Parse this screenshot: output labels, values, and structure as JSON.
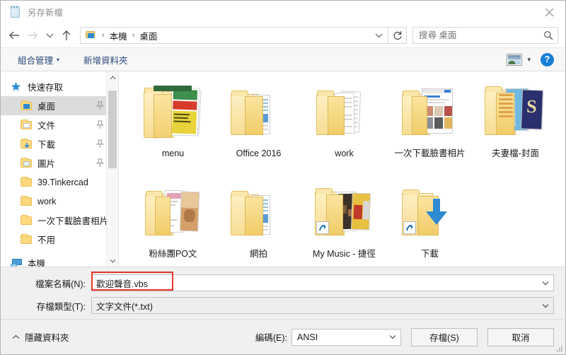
{
  "window": {
    "title": "另存新檔",
    "icon": "notepad-icon",
    "close_label": "✕"
  },
  "nav": {
    "back": "←",
    "forward": "→",
    "recent": "⌄",
    "up": "↑",
    "breadcrumb": [
      "本機",
      "桌面"
    ],
    "breadcrumb_separator": "›",
    "address_chevron": "⌄",
    "refresh": "↻"
  },
  "search": {
    "placeholder": "搜尋 桌面",
    "value": "",
    "icon": "search-icon"
  },
  "command_bar": {
    "organize": "組合管理",
    "organize_caret": "▾",
    "new_folder": "新增資料夾",
    "view_caret": "▾",
    "help": "?"
  },
  "sidebar": {
    "items": [
      {
        "label": "快速存取",
        "icon": "star-icon",
        "level": 1,
        "selected": false,
        "pinned": false
      },
      {
        "label": "桌面",
        "icon": "folder-desktop",
        "level": 2,
        "selected": true,
        "pinned": true
      },
      {
        "label": "文件",
        "icon": "folder-docs",
        "level": 2,
        "selected": false,
        "pinned": true
      },
      {
        "label": "下載",
        "icon": "folder-downloads",
        "level": 2,
        "selected": false,
        "pinned": true
      },
      {
        "label": "圖片",
        "icon": "folder-pictures",
        "level": 2,
        "selected": false,
        "pinned": true
      },
      {
        "label": "39.Tinkercad",
        "icon": "folder-plain",
        "level": 2,
        "selected": false,
        "pinned": false
      },
      {
        "label": "work",
        "icon": "folder-plain",
        "level": 2,
        "selected": false,
        "pinned": false
      },
      {
        "label": "一次下載臉書相片",
        "icon": "folder-plain",
        "level": 2,
        "selected": false,
        "pinned": false
      },
      {
        "label": "不用",
        "icon": "folder-plain",
        "level": 2,
        "selected": false,
        "pinned": false
      },
      {
        "label": "本機",
        "icon": "this-pc-icon",
        "level": 1,
        "selected": false,
        "pinned": false
      }
    ],
    "scroll_up": "⌃",
    "scroll_down": "⌄"
  },
  "files": {
    "items": [
      {
        "name": "menu",
        "kind": "folder-thumb-menu",
        "shortcut": false
      },
      {
        "name": "Office 2016",
        "kind": "folder-thumb-doc",
        "shortcut": false
      },
      {
        "name": "work",
        "kind": "folder-thumb-sheets",
        "shortcut": false
      },
      {
        "name": "一次下載臉書相片",
        "kind": "folder-thumb-web",
        "shortcut": false
      },
      {
        "name": "夫妻檔-封面",
        "kind": "folder-thumb-cover",
        "shortcut": false
      },
      {
        "name": "粉絲團PO文",
        "kind": "folder-thumb-po",
        "shortcut": false
      },
      {
        "name": "網拍",
        "kind": "folder-thumb-doc",
        "shortcut": false
      },
      {
        "name": "My Music - 捷徑",
        "kind": "folder-thumb-music",
        "shortcut": true
      },
      {
        "name": "下載",
        "kind": "folder-download-arrow",
        "shortcut": true
      }
    ]
  },
  "form": {
    "filename_label": "檔案名稱(N):",
    "filename_value": "歡迎聲音.vbs",
    "filetype_label": "存檔類型(T):",
    "filetype_value": "文字文件(*.txt)",
    "combo_caret": "⌄"
  },
  "footer": {
    "hide_folders": "隱藏資料夾",
    "hide_folders_chevron": "⌃",
    "encoding_label": "編碼(E):",
    "encoding_value": "ANSI",
    "save_button": "存檔(S)",
    "cancel_button": "取消"
  },
  "annotation": {
    "highlight_color": "#e8332a",
    "target": "filename-input"
  }
}
